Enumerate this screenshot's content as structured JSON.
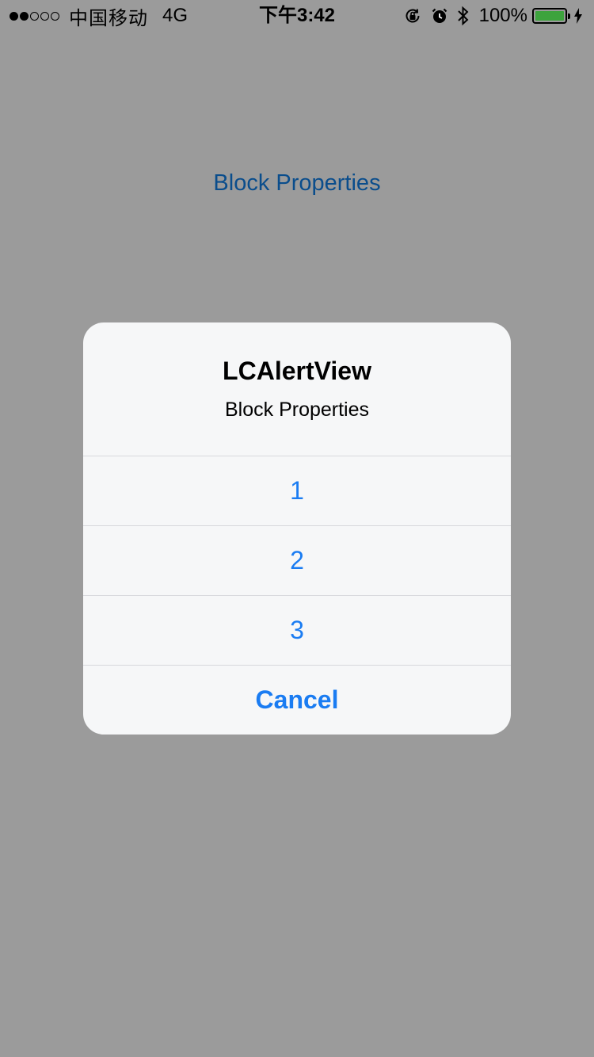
{
  "status_bar": {
    "carrier": "中国移动",
    "network": "4G",
    "time": "下午3:42",
    "battery_percent": "100%",
    "signal_bars_filled": 2,
    "signal_bars_total": 5,
    "battery_color": "#3da33d",
    "icons": [
      "signal-dots-icon",
      "orientation-lock-icon",
      "alarm-icon",
      "bluetooth-icon",
      "battery-icon",
      "charging-bolt-icon"
    ]
  },
  "page": {
    "title": "Block Properties",
    "title_color": "#0a4d8c",
    "background_color": "#9b9b9b"
  },
  "alert": {
    "title": "LCAlertView",
    "message": "Block Properties",
    "buttons": [
      {
        "label": "1"
      },
      {
        "label": "2"
      },
      {
        "label": "3"
      }
    ],
    "cancel_label": "Cancel",
    "button_color": "#1a7cf2"
  }
}
